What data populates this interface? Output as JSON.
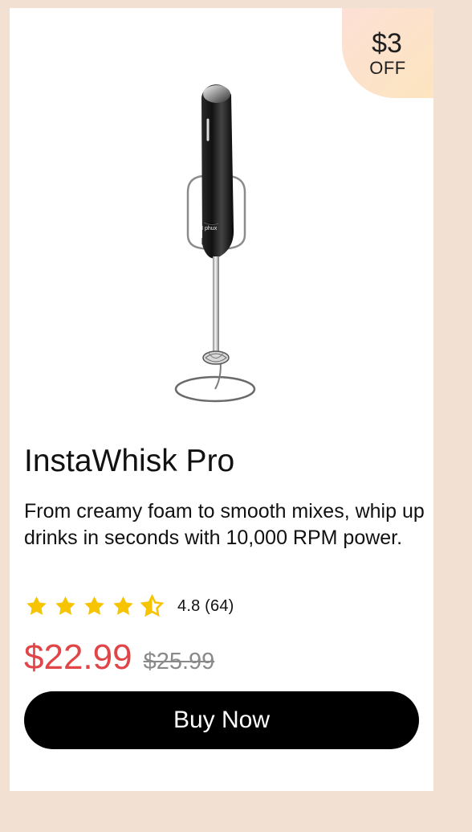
{
  "offer_badge": {
    "amount": "$3",
    "label": "OFF",
    "gradient_start": "#fde0d6",
    "gradient_end": "#fce5bf"
  },
  "product": {
    "image_icon": "milk-frother-product-image",
    "title": "InstaWhisk Pro",
    "description": "From creamy foam to smooth mixes, whip up drinks in seconds with 10,000 RPM power."
  },
  "rating": {
    "stars": 4.5,
    "text": "4.8 (64)",
    "star_color": "#f6c400"
  },
  "pricing": {
    "current_price": "$22.99",
    "original_price": "$25.99",
    "current_color": "#e04548",
    "original_color": "#8a8a8a"
  },
  "actions": {
    "buy_label": "Buy Now"
  },
  "colors": {
    "background": "#f2e0d3",
    "card": "#ffffff",
    "button": "#000000"
  }
}
